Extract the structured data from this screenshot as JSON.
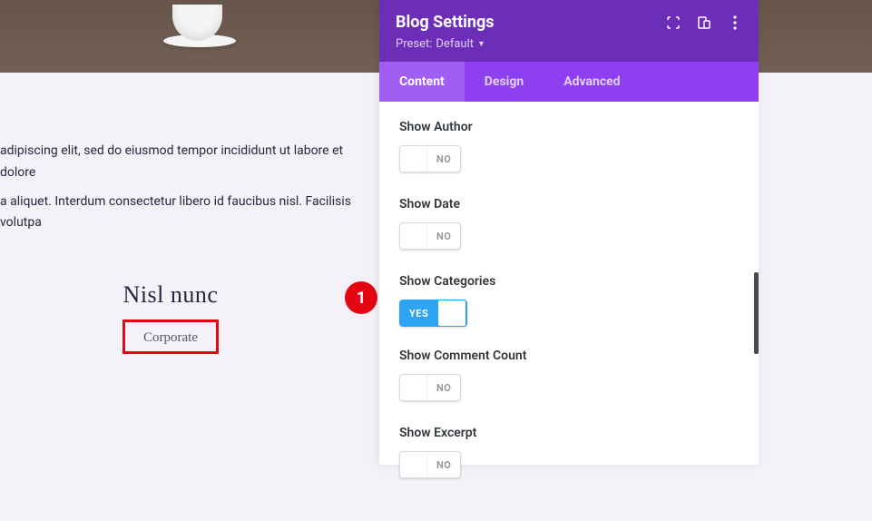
{
  "page": {
    "paragraph_line1": "adipiscing elit, sed do eiusmod tempor incididunt ut labore et dolore",
    "paragraph_line2": "a aliquet. Interdum consectetur libero id faucibus nisl. Facilisis volutpa"
  },
  "post": {
    "title": "Nisl nunc",
    "category": "Corporate"
  },
  "marker": {
    "number": "1"
  },
  "panel": {
    "title": "Blog Settings",
    "preset_label": "Preset:",
    "preset_value": "Default",
    "tabs": {
      "content": "Content",
      "design": "Design",
      "advanced": "Advanced"
    },
    "settings": {
      "show_author": {
        "label": "Show Author",
        "value": "NO"
      },
      "show_date": {
        "label": "Show Date",
        "value": "NO"
      },
      "show_categories": {
        "label": "Show Categories",
        "value": "YES"
      },
      "show_comment_count": {
        "label": "Show Comment Count",
        "value": "NO"
      },
      "show_excerpt": {
        "label": "Show Excerpt",
        "value": "NO"
      }
    }
  }
}
